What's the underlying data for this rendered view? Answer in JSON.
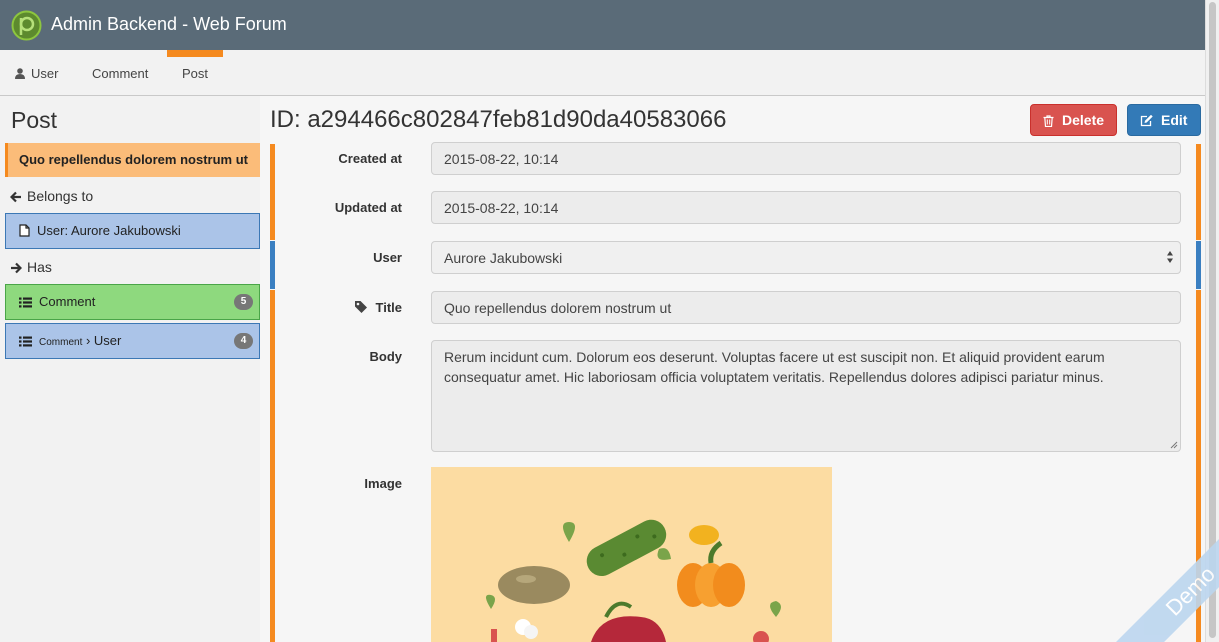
{
  "app": {
    "title": "Admin Backend - Web Forum"
  },
  "nav": {
    "items": [
      {
        "label": "User",
        "icon": "user-icon"
      },
      {
        "label": "Comment"
      },
      {
        "label": "Post",
        "active": true
      }
    ]
  },
  "sidebar": {
    "title": "Post",
    "current_item": "Quo repellendus dolorem nostrum ut",
    "belongs_to_heading": "Belongs to",
    "belongs_to": [
      {
        "label": "User: Aurore Jakubowski",
        "icon": "document-icon"
      }
    ],
    "has_heading": "Has",
    "has": [
      {
        "label": "Comment",
        "count": "5",
        "icon": "list-icon"
      },
      {
        "prefix": "Comment",
        "label": "User",
        "count": "4",
        "icon": "list-icon"
      }
    ]
  },
  "record": {
    "id_title": "ID: a294466c802847feb81d90da40583066",
    "delete_label": "Delete",
    "edit_label": "Edit",
    "fields": {
      "created_at": {
        "label": "Created at",
        "value": "2015-08-22, 10:14"
      },
      "updated_at": {
        "label": "Updated at",
        "value": "2015-08-22, 10:14"
      },
      "user": {
        "label": "User",
        "value": "Aurore Jakubowski"
      },
      "title": {
        "label": "Title",
        "value": "Quo repellendus dolorem nostrum ut"
      },
      "body": {
        "label": "Body",
        "value": "Rerum incidunt cum. Dolorum eos deserunt. Voluptas facere ut est suscipit non. Et aliquid provident earum consequatur amet. Hic laboriosam officia voluptatem veritatis. Repellendus dolores adipisci pariatur minus."
      },
      "image": {
        "label": "Image"
      }
    }
  },
  "ribbon": {
    "label": "Demo"
  },
  "colors": {
    "topbar": "#5a6b78",
    "accent_orange": "#f58a1f",
    "current_item_bg": "#fbbc79",
    "relation_blue": "#abc4e8",
    "relation_green": "#8ed97e",
    "delete": "#d9534f",
    "edit": "#337ab7"
  }
}
